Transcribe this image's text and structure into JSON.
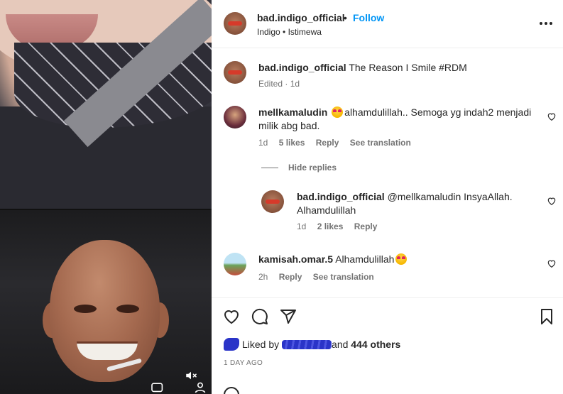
{
  "post": {
    "author": "bad.indigo_official",
    "dot": "•",
    "follow_label": "Follow",
    "subtitle": "Indigo • Istimewa"
  },
  "caption": {
    "author": "bad.indigo_official",
    "text": "The Reason I Smile #RDM",
    "meta": "Edited · 1d"
  },
  "comments": [
    {
      "author": "mellkamaludin",
      "text": "alhamdulillah.. Semoga yg indah2 menjadi milik abg bad.",
      "time": "1d",
      "likes": "5 likes",
      "reply": "Reply",
      "translate": "See translation"
    },
    {
      "author": "kamisah.omar.5",
      "text": "Alhamdulillah",
      "time": "2h",
      "reply": "Reply",
      "translate": "See translation"
    }
  ],
  "hide_replies": "Hide replies",
  "reply": {
    "author": "bad.indigo_official",
    "text": "@mellkamaludin InsyaAllah. Alhamdulillah",
    "time": "1d",
    "likes": "2 likes",
    "reply": "Reply"
  },
  "actions": {
    "liked_by": "Liked by",
    "and": "and",
    "others": "444 others",
    "date": "1 DAY AGO"
  },
  "icons": [
    "heart-icon",
    "comment-icon",
    "share-icon",
    "bookmark-icon",
    "more-icon",
    "mute-icon"
  ],
  "colors": {
    "accent": "#0095f6",
    "text": "#262626",
    "muted": "#737373",
    "redaction": "#2a34c8"
  }
}
